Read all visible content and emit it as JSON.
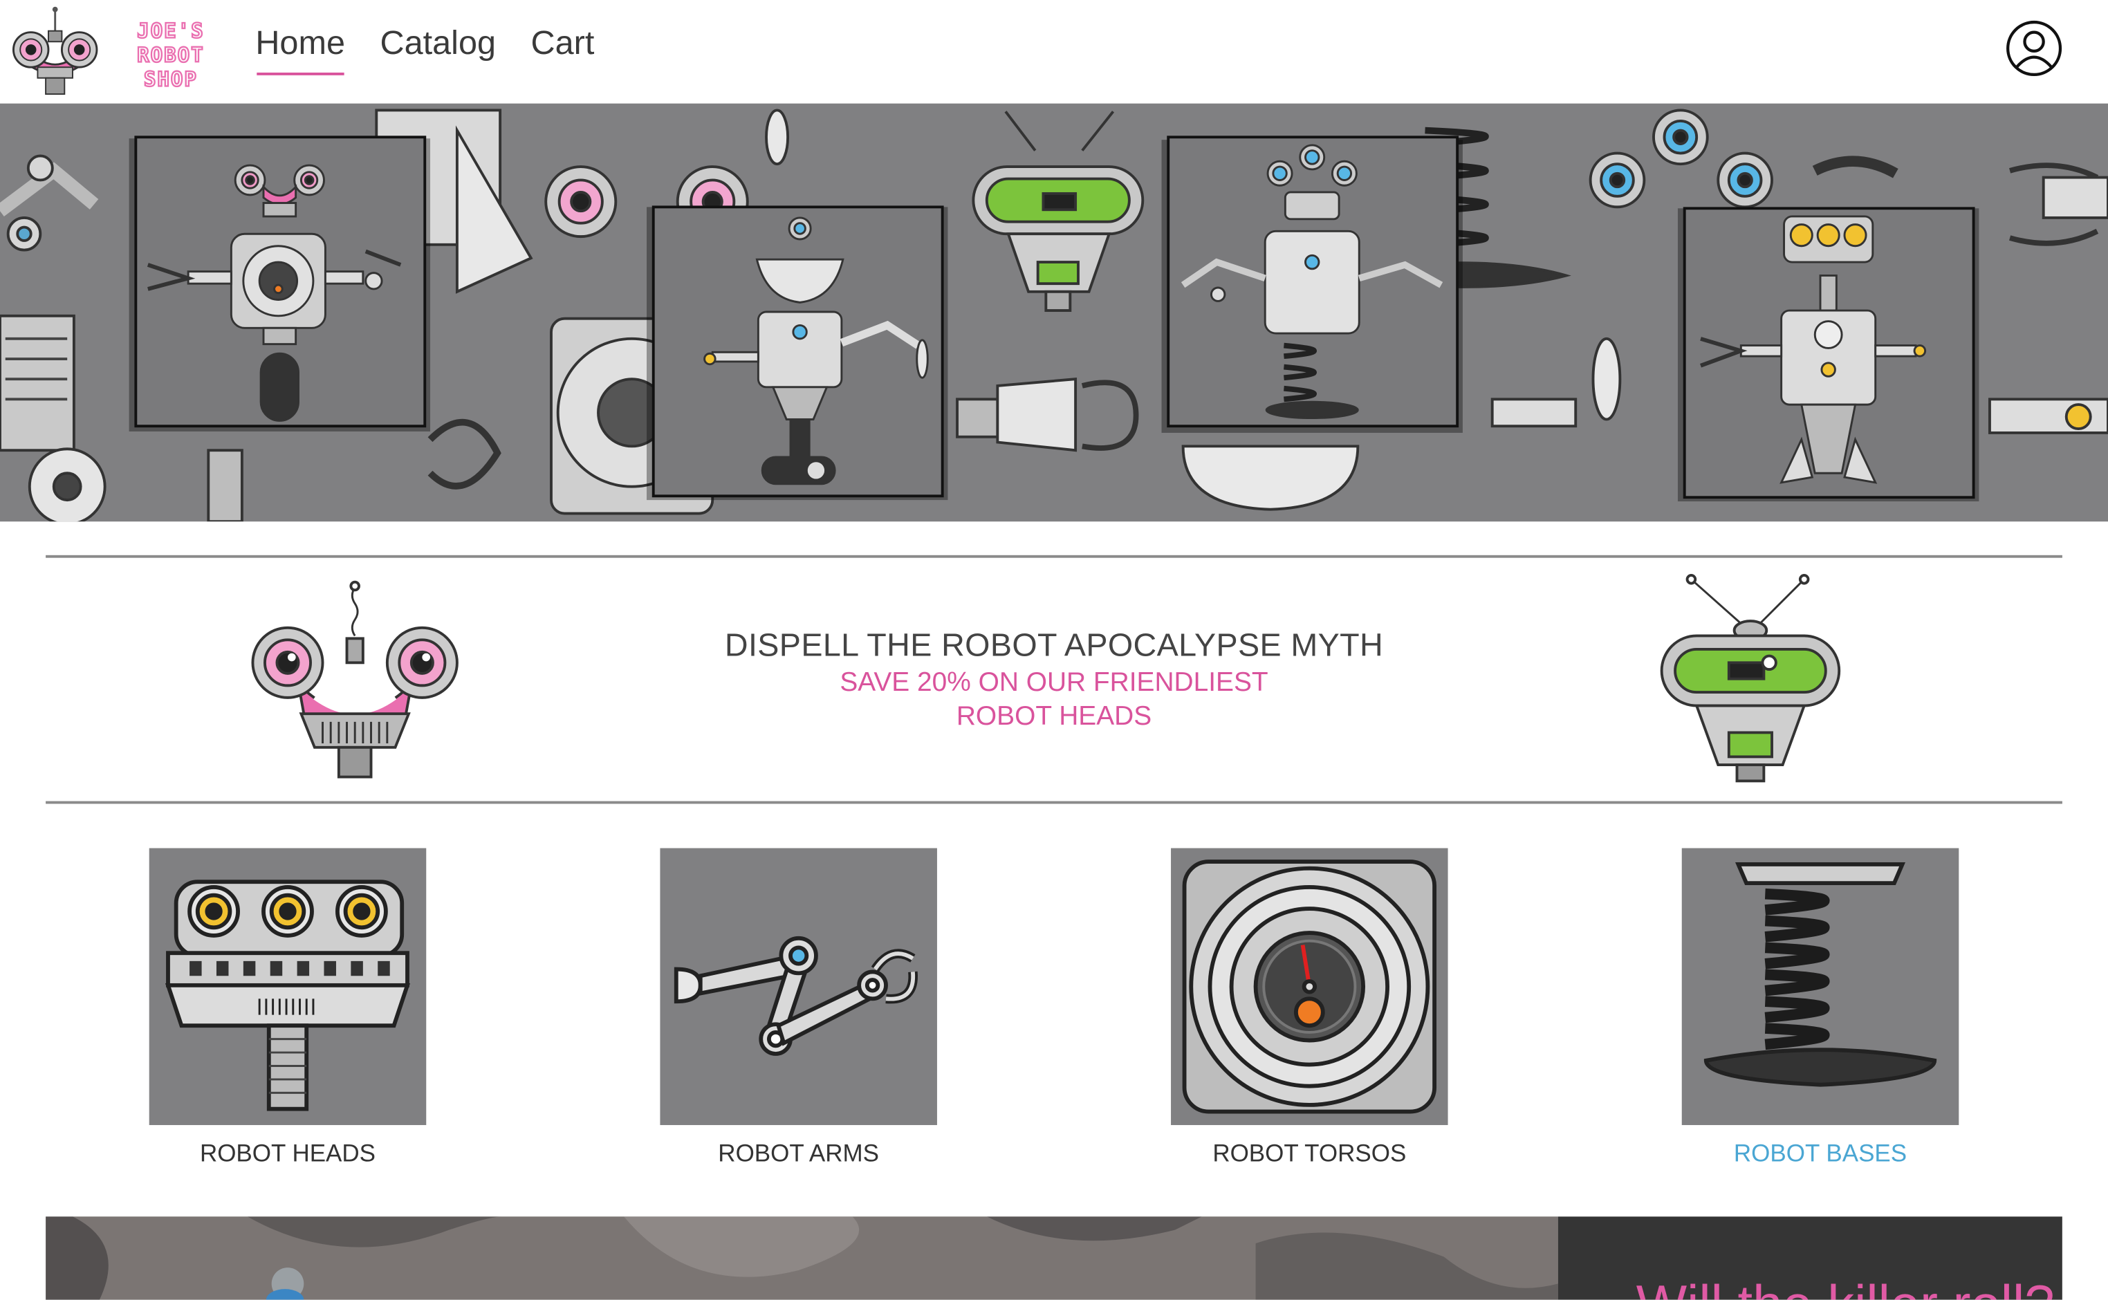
{
  "brand": {
    "logo_text": [
      "JOE'S",
      "ROBOT",
      "SHOP"
    ],
    "accent_color": "#d9539c"
  },
  "nav": {
    "items": [
      {
        "label": "Home",
        "active": true
      },
      {
        "label": "Catalog",
        "active": false
      },
      {
        "label": "Cart",
        "active": false
      }
    ],
    "user_icon": "user-circle-icon"
  },
  "promo": {
    "title": "DISPELL THE ROBOT APOCALYPSE MYTH",
    "subtitle_line1": "SAVE 20% ON OUR FRIENDLIEST",
    "subtitle_line2": "ROBOT HEADS"
  },
  "categories": [
    {
      "label": "ROBOT HEADS",
      "icon": "robot-head-icon"
    },
    {
      "label": "ROBOT ARMS",
      "icon": "robot-arm-icon"
    },
    {
      "label": "ROBOT TORSOS",
      "icon": "robot-torso-icon"
    },
    {
      "label": "ROBOT BASES",
      "icon": "robot-base-icon",
      "highlight_color": "#4aa6d3"
    }
  ],
  "bottom": {
    "title": "Will the killer roll?"
  }
}
